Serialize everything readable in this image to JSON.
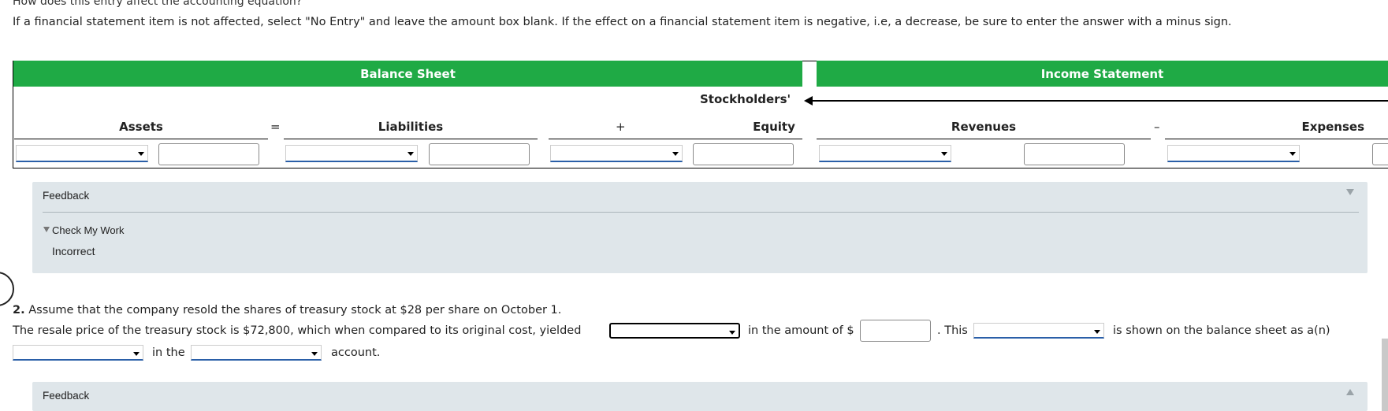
{
  "question_top": "How does this entry affect the accounting equation?",
  "instructions": "If a financial statement item is not affected, select \"No Entry\" and leave the amount box blank. If the effect on a financial statement item is negative, i.e, a decrease, be sure to enter the answer with a minus sign.",
  "table": {
    "balance_sheet_header": "Balance Sheet",
    "income_statement_header": "Income Statement",
    "stockholders_label": "Stockholders'",
    "columns": {
      "assets": "Assets",
      "equals": "=",
      "liabilities": "Liabilities",
      "plus": "+",
      "equity": "Equity",
      "revenues": "Revenues",
      "minus": "–",
      "expenses": "Expenses"
    },
    "header_color": "#1faa45"
  },
  "feedback1": {
    "title": "Feedback",
    "check_my_work": "Check My Work",
    "result": "Incorrect"
  },
  "q2": {
    "number": "2.",
    "prompt": "Assume that the company resold the shares of treasury stock at $28 per share on October 1.",
    "sentence_part1": "The resale price of the treasury stock is $72,800, which when compared to its original cost, yielded",
    "sentence_part2": "in the amount of $",
    "sentence_part3": ". This",
    "sentence_part4": "is shown on the balance sheet as a(n)",
    "sentence_part5": "in the",
    "sentence_part6": "account."
  },
  "feedback2": {
    "title": "Feedback"
  }
}
